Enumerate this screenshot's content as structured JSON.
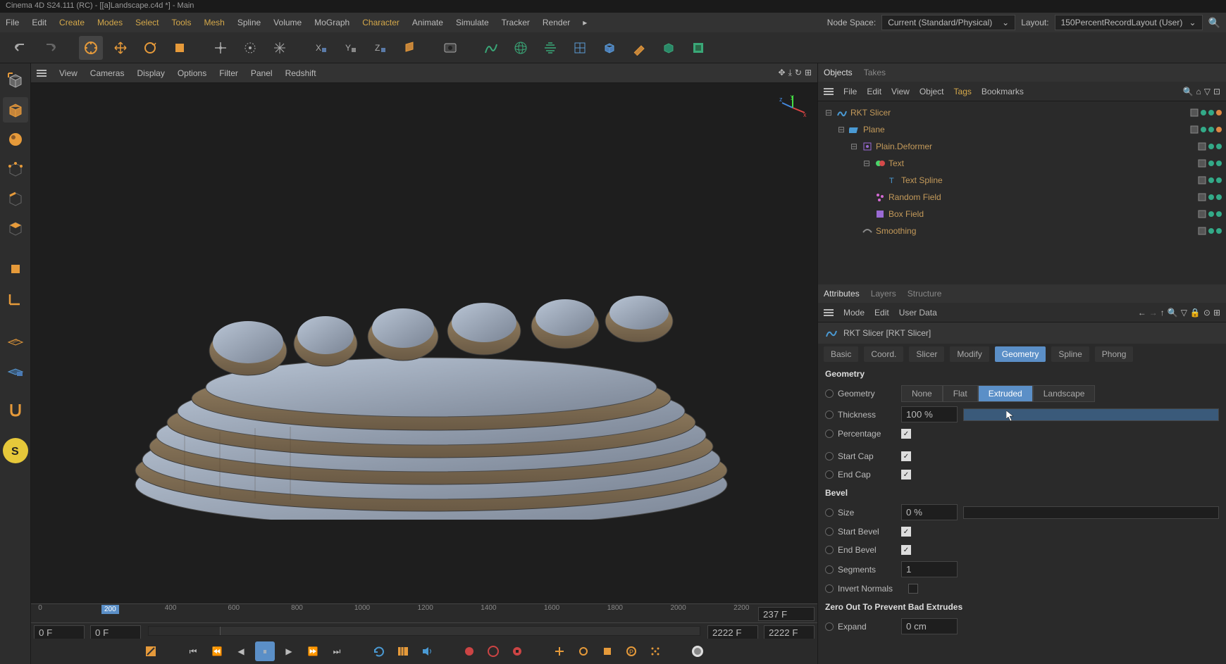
{
  "titlebar": "Cinema 4D S24.111 (RC) - [[a]Landscape.c4d *] - Main",
  "menu": {
    "items": [
      "File",
      "Edit",
      "Create",
      "Modes",
      "Select",
      "Tools",
      "Mesh",
      "Spline",
      "Volume",
      "MoGraph",
      "Character",
      "Animate",
      "Simulate",
      "Tracker",
      "Render"
    ],
    "node_space_label": "Node Space:",
    "node_space_value": "Current (Standard/Physical)",
    "layout_label": "Layout:",
    "layout_value": "150PercentRecordLayout (User)"
  },
  "viewport_menu": [
    "View",
    "Cameras",
    "Display",
    "Options",
    "Filter",
    "Panel",
    "Redshift"
  ],
  "axis": {
    "x": "x",
    "y": "y",
    "z": "z"
  },
  "timeline": {
    "ticks": [
      "0",
      "200",
      "400",
      "600",
      "800",
      "1000",
      "1200",
      "1400",
      "1600",
      "1800",
      "2000",
      "2200"
    ],
    "current": "200",
    "frame_right": "237 F",
    "frame_left": "0 F",
    "frame_left2": "0 F",
    "frame_end": "2222 F",
    "frame_end2": "2222 F"
  },
  "objects_panel": {
    "tabs": [
      "Objects",
      "Takes"
    ],
    "menu": [
      "File",
      "Edit",
      "View",
      "Object",
      "Tags",
      "Bookmarks"
    ],
    "tree": [
      {
        "indent": 0,
        "label": "RKT Slicer",
        "color": "orange",
        "icon": "slicer",
        "expanded": true
      },
      {
        "indent": 1,
        "label": "Plane",
        "color": "orange",
        "icon": "plane",
        "expanded": true
      },
      {
        "indent": 2,
        "label": "Plain.Deformer",
        "color": "orange",
        "icon": "deformer",
        "expanded": true
      },
      {
        "indent": 3,
        "label": "Text",
        "color": "orange",
        "icon": "text",
        "expanded": true
      },
      {
        "indent": 4,
        "label": "Text Spline",
        "color": "orange",
        "icon": "spline",
        "expanded": false
      },
      {
        "indent": 3,
        "label": "Random Field",
        "color": "orange",
        "icon": "random",
        "expanded": false
      },
      {
        "indent": 3,
        "label": "Box Field",
        "color": "orange",
        "icon": "box",
        "expanded": false
      },
      {
        "indent": 2,
        "label": "Smoothing",
        "color": "orange",
        "icon": "smooth",
        "expanded": false
      }
    ]
  },
  "attributes_panel": {
    "tabs": [
      "Attributes",
      "Layers",
      "Structure"
    ],
    "menu": [
      "Mode",
      "Edit",
      "User Data"
    ],
    "object_name": "RKT Slicer [RKT Slicer]",
    "sub_tabs": [
      "Basic",
      "Coord.",
      "Slicer",
      "Modify",
      "Geometry",
      "Spline",
      "Phong"
    ],
    "sub_tab_active": "Geometry",
    "geometry": {
      "header": "Geometry",
      "geometry_label": "Geometry",
      "geometry_options": [
        "None",
        "Flat",
        "Extruded",
        "Landscape"
      ],
      "geometry_active": "Extruded",
      "thickness_label": "Thickness",
      "thickness_value": "100 %",
      "percentage_label": "Percentage",
      "percentage_checked": true,
      "start_cap_label": "Start Cap",
      "start_cap_checked": true,
      "end_cap_label": "End Cap",
      "end_cap_checked": true
    },
    "bevel": {
      "header": "Bevel",
      "size_label": "Size",
      "size_value": "0 %",
      "start_bevel_label": "Start Bevel",
      "start_bevel_checked": true,
      "end_bevel_label": "End Bevel",
      "end_bevel_checked": true,
      "segments_label": "Segments",
      "segments_value": "1",
      "invert_label": "Invert Normals",
      "invert_checked": false
    },
    "zero_out": {
      "header": "Zero Out To Prevent Bad Extrudes",
      "expand_label": "Expand",
      "expand_value": "0 cm"
    }
  }
}
